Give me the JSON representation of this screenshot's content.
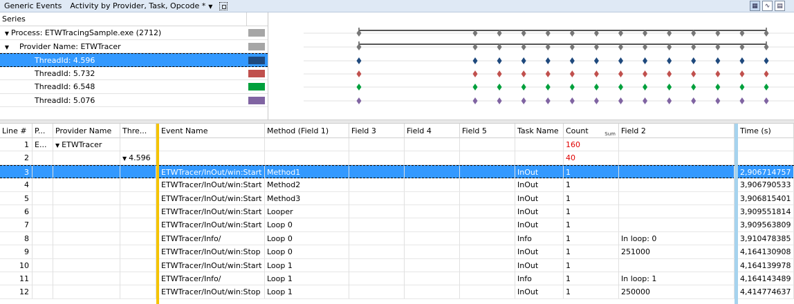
{
  "toolbar": {
    "title": "Generic Events",
    "preset": "Activity by Provider, Task, Opcode *",
    "caret": "▼"
  },
  "series": {
    "header": "Series",
    "rows": [
      {
        "label": "Process: ETWTracingSample.exe (2712)",
        "level": 0,
        "expanded": true,
        "color": "#a6a6a6",
        "selected": false
      },
      {
        "label": "Provider Name: ETWTracer",
        "level": 1,
        "expanded": true,
        "color": "#a6a6a6",
        "selected": false
      },
      {
        "label": "ThreadId: 4.596",
        "level": 2,
        "expanded": false,
        "color": "#1f497d",
        "selected": true
      },
      {
        "label": "ThreadId: 5.732",
        "level": 2,
        "expanded": false,
        "color": "#c0504d",
        "selected": false
      },
      {
        "label": "ThreadId: 6.548",
        "level": 2,
        "expanded": false,
        "color": "#00a03c",
        "selected": false
      },
      {
        "label": "ThreadId: 5.076",
        "level": 2,
        "expanded": false,
        "color": "#8064a2",
        "selected": false
      }
    ]
  },
  "graph": {
    "marker_rows": [
      {
        "color": "#777777",
        "bar": true
      },
      {
        "color": "#777777",
        "bar": true
      },
      {
        "color": "#1f497d",
        "bar": false
      },
      {
        "color": "#c0504d",
        "bar": false
      },
      {
        "color": "#00a03c",
        "bar": false
      },
      {
        "color": "#8064a2",
        "bar": false
      }
    ],
    "marker_count": 14
  },
  "table": {
    "columns": [
      {
        "label": "Line #",
        "key": "line"
      },
      {
        "label": "P...",
        "key": "p"
      },
      {
        "label": "Provider Name",
        "key": "provider"
      },
      {
        "label": "Thre...",
        "key": "thread"
      },
      {
        "label": "Event Name",
        "key": "event"
      },
      {
        "label": "Method (Field 1)",
        "key": "method"
      },
      {
        "label": "Field 3",
        "key": "f3"
      },
      {
        "label": "Field 4",
        "key": "f4"
      },
      {
        "label": "Field 5",
        "key": "f5"
      },
      {
        "label": "Task Name",
        "key": "task"
      },
      {
        "label": "Count",
        "key": "count"
      },
      {
        "label": "Field 2",
        "key": "f2"
      },
      {
        "label": "Time (s)",
        "key": "time"
      }
    ],
    "count_sum_label": "Sum",
    "rows": [
      {
        "line": "1",
        "p": "E...",
        "provider": "ETWTracer",
        "provider_tri": true,
        "thread": "",
        "thread_tri": false,
        "event": "",
        "method": "",
        "f3": "",
        "f4": "",
        "f5": "",
        "task": "",
        "count": "160",
        "count_red": true,
        "f2": "",
        "time": "",
        "selected": false
      },
      {
        "line": "2",
        "p": "",
        "provider": "",
        "provider_tri": false,
        "thread": "4.596",
        "thread_tri": true,
        "event": "",
        "method": "",
        "f3": "",
        "f4": "",
        "f5": "",
        "task": "",
        "count": "40",
        "count_red": true,
        "f2": "",
        "time": "",
        "selected": false
      },
      {
        "line": "3",
        "p": "",
        "provider": "",
        "provider_tri": false,
        "thread": "",
        "thread_tri": false,
        "event": "ETWTracer/InOut/win:Start",
        "method": "Method1",
        "f3": "",
        "f4": "",
        "f5": "",
        "task": "InOut",
        "count": "1",
        "count_red": false,
        "f2": "",
        "time": "2,906714757",
        "selected": true
      },
      {
        "line": "4",
        "p": "",
        "provider": "",
        "provider_tri": false,
        "thread": "",
        "thread_tri": false,
        "event": "ETWTracer/InOut/win:Start",
        "method": "Method2",
        "f3": "",
        "f4": "",
        "f5": "",
        "task": "InOut",
        "count": "1",
        "count_red": false,
        "f2": "",
        "time": "3,906790533",
        "selected": false
      },
      {
        "line": "5",
        "p": "",
        "provider": "",
        "provider_tri": false,
        "thread": "",
        "thread_tri": false,
        "event": "ETWTracer/InOut/win:Start",
        "method": "Method3",
        "f3": "",
        "f4": "",
        "f5": "",
        "task": "InOut",
        "count": "1",
        "count_red": false,
        "f2": "",
        "time": "3,906815401",
        "selected": false
      },
      {
        "line": "6",
        "p": "",
        "provider": "",
        "provider_tri": false,
        "thread": "",
        "thread_tri": false,
        "event": "ETWTracer/InOut/win:Start",
        "method": "Looper",
        "f3": "",
        "f4": "",
        "f5": "",
        "task": "InOut",
        "count": "1",
        "count_red": false,
        "f2": "",
        "time": "3,909551814",
        "selected": false
      },
      {
        "line": "7",
        "p": "",
        "provider": "",
        "provider_tri": false,
        "thread": "",
        "thread_tri": false,
        "event": "ETWTracer/InOut/win:Start",
        "method": "Loop 0",
        "f3": "",
        "f4": "",
        "f5": "",
        "task": "InOut",
        "count": "1",
        "count_red": false,
        "f2": "",
        "time": "3,909563809",
        "selected": false
      },
      {
        "line": "8",
        "p": "",
        "provider": "",
        "provider_tri": false,
        "thread": "",
        "thread_tri": false,
        "event": "ETWTracer/Info/",
        "method": "Loop 0",
        "f3": "",
        "f4": "",
        "f5": "",
        "task": "Info",
        "count": "1",
        "count_red": false,
        "f2": "In loop: 0",
        "time": "3,910478385",
        "selected": false
      },
      {
        "line": "9",
        "p": "",
        "provider": "",
        "provider_tri": false,
        "thread": "",
        "thread_tri": false,
        "event": "ETWTracer/InOut/win:Stop",
        "method": "Loop 0",
        "f3": "",
        "f4": "",
        "f5": "",
        "task": "InOut",
        "count": "1",
        "count_red": false,
        "f2": "251000",
        "time": "4,164130908",
        "selected": false
      },
      {
        "line": "10",
        "p": "",
        "provider": "",
        "provider_tri": false,
        "thread": "",
        "thread_tri": false,
        "event": "ETWTracer/InOut/win:Start",
        "method": "Loop 1",
        "f3": "",
        "f4": "",
        "f5": "",
        "task": "InOut",
        "count": "1",
        "count_red": false,
        "f2": "",
        "time": "4,164139978",
        "selected": false
      },
      {
        "line": "11",
        "p": "",
        "provider": "",
        "provider_tri": false,
        "thread": "",
        "thread_tri": false,
        "event": "ETWTracer/Info/",
        "method": "Loop 1",
        "f3": "",
        "f4": "",
        "f5": "",
        "task": "Info",
        "count": "1",
        "count_red": false,
        "f2": "In loop: 1",
        "time": "4,164143489",
        "selected": false
      },
      {
        "line": "12",
        "p": "",
        "provider": "",
        "provider_tri": false,
        "thread": "",
        "thread_tri": false,
        "event": "ETWTracer/InOut/win:Stop",
        "method": "Loop 1",
        "f3": "",
        "f4": "",
        "f5": "",
        "task": "InOut",
        "count": "1",
        "count_red": false,
        "f2": "250000",
        "time": "4,414774637",
        "selected": false
      }
    ]
  },
  "icons": {
    "grid": "grid-toggle-icon",
    "view_table": "table-view-icon",
    "view_graph": "graph-view-icon",
    "view_both": "graph-and-table-icon"
  }
}
